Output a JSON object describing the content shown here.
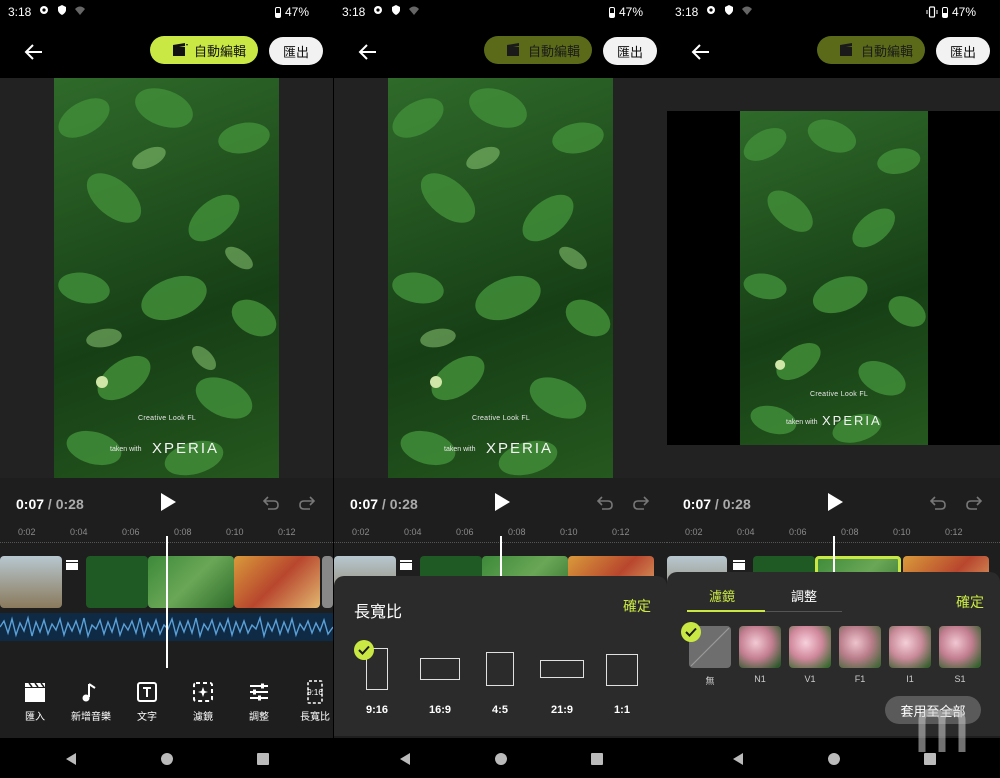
{
  "status": {
    "time": "3:18",
    "battery": "47%"
  },
  "topbar": {
    "auto_edit_label": "自動編輯",
    "export_label": "匯出"
  },
  "colors": {
    "accent": "#c9e843",
    "panel_bg": "#1e1e1e",
    "sheet_bg": "#2b2b2b"
  },
  "preview": {
    "watermark_line1": "Creative Look FL",
    "watermark_line2": "taken with",
    "watermark_brand": "XPERIA"
  },
  "timeline": {
    "current": "0:07",
    "separator": "/",
    "total": "0:28",
    "ticks": [
      "0:02",
      "0:04",
      "0:06",
      "0:08",
      "0:10",
      "0:12"
    ]
  },
  "toolbar": {
    "items": [
      {
        "label": "匯入",
        "icon": "clapperboard-icon"
      },
      {
        "label": "新增音樂",
        "icon": "music-note-icon"
      },
      {
        "label": "文字",
        "icon": "text-box-icon"
      },
      {
        "label": "濾鏡",
        "icon": "sparkle-filter-icon"
      },
      {
        "label": "調整",
        "icon": "sliders-icon"
      },
      {
        "label": "長寬比",
        "icon": "aspect-ratio-icon",
        "icon_text": "9:16"
      }
    ]
  },
  "aspect_sheet": {
    "title": "長寬比",
    "confirm": "確定",
    "selected": "9:16",
    "options": [
      "9:16",
      "16:9",
      "4:5",
      "21:9",
      "1:1"
    ]
  },
  "filter_sheet": {
    "tabs": [
      "濾鏡",
      "調整"
    ],
    "active_tab": "濾鏡",
    "confirm": "確定",
    "selected": "無",
    "filters": [
      "無",
      "N1",
      "V1",
      "F1",
      "I1",
      "S1"
    ],
    "apply_all": "套用至全部"
  }
}
